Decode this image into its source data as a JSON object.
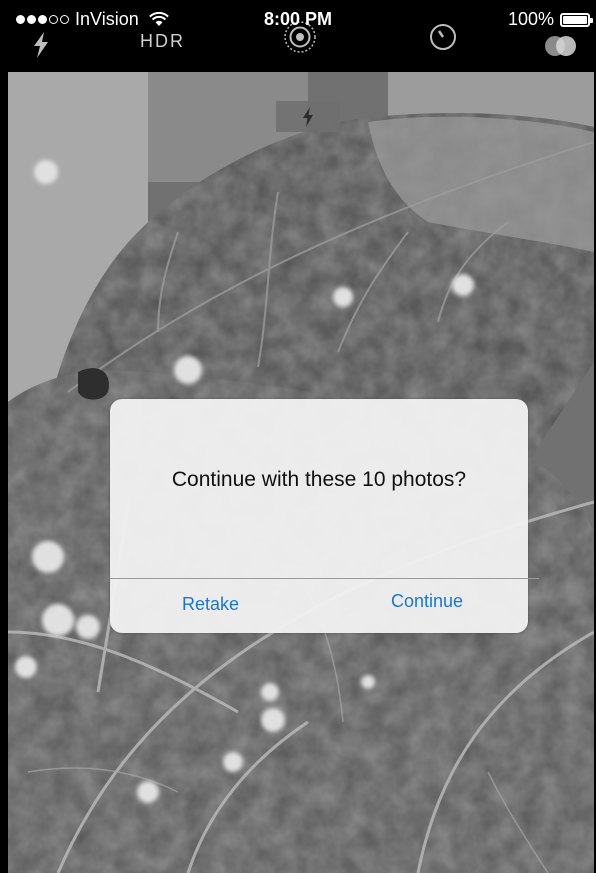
{
  "status_bar": {
    "carrier": "InVision",
    "time": "8:00 PM",
    "battery_percent_text": "100%",
    "battery_level": 1.0,
    "signal_bars_filled": 3,
    "signal_bars_total": 5
  },
  "camera_controls": {
    "hdr_label": "HDR",
    "icons": [
      "flash-auto-icon",
      "live-photo-icon",
      "timer-icon",
      "filters-icon"
    ]
  },
  "viewfinder": {
    "flash_icon": "lightning-bolt-icon"
  },
  "alert": {
    "message": "Continue with these 10 photos?",
    "retake_label": "Retake",
    "continue_label": "Continue",
    "button_color": "#1877d4"
  }
}
